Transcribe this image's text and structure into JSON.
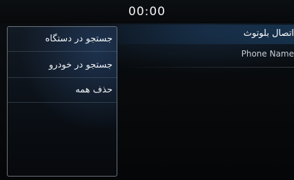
{
  "status_bar": {
    "time": "00:00"
  },
  "bluetooth_panel": {
    "title": "اتصال بلوتوث",
    "device_name": "Phone Name"
  },
  "popup_menu": {
    "items": [
      {
        "label": "جستجو در دستگاه"
      },
      {
        "label": "جستجو در خودرو"
      },
      {
        "label": "حذف همه"
      }
    ]
  }
}
